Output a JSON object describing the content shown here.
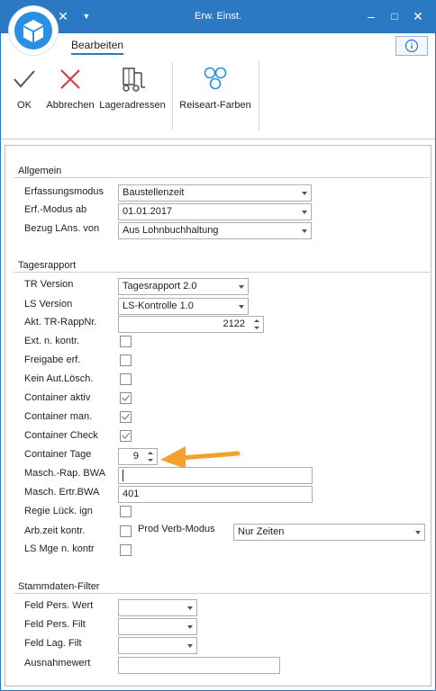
{
  "window": {
    "title": "Erw. Einst."
  },
  "ribbon": {
    "tab": "Bearbeiten",
    "buttons": {
      "ok": "OK",
      "cancel": "Abbrechen",
      "addresses": "Lageradressen",
      "colors": "Reiseart-Farben"
    }
  },
  "allgemein": {
    "title": "Allgemein",
    "erfassungsmodus_label": "Erfassungsmodus",
    "erfassungsmodus_value": "Baustellenzeit",
    "erf_modus_ab_label": "Erf.-Modus ab",
    "erf_modus_ab_value": "01.01.2017",
    "bezug_label": "Bezug LAns. von",
    "bezug_value": "Aus Lohnbuchhaltung"
  },
  "tagesrapport": {
    "title": "Tagesrapport",
    "tr_version_label": "TR Version",
    "tr_version_value": "Tagesrapport 2.0",
    "ls_version_label": "LS Version",
    "ls_version_value": "LS-Kontrolle 1.0",
    "akt_tr_label": "Akt. TR-RappNr.",
    "akt_tr_value": "2122",
    "ext_label": "Ext. n. kontr.",
    "freigabe_label": "Freigabe erf.",
    "kein_label": "Kein Aut.Lösch.",
    "container_aktiv_label": "Container aktiv",
    "container_man_label": "Container man.",
    "container_check_label": "Container Check",
    "container_tage_label": "Container Tage",
    "container_tage_value": "9",
    "masch_rap_label": "Masch.-Rap. BWA",
    "masch_rap_value": "",
    "masch_ertr_label": "Masch. Ertr.BWA",
    "masch_ertr_value": "401",
    "regie_label": "Regie Lück. ign",
    "arbzeit_label": "Arb.zeit kontr.",
    "prod_label": "Prod Verb-Modus",
    "prod_value": "Nur Zeiten",
    "ls_mge_label": "LS Mge n. kontr"
  },
  "stammdaten": {
    "title": "Stammdaten-Filter",
    "feld_pers_wert_label": "Feld Pers. Wert",
    "feld_pers_filt_label": "Feld Pers. Filt",
    "feld_lag_filt_label": "Feld Lag. Filt",
    "ausnahmewert_label": "Ausnahmewert"
  },
  "colors": {
    "accent": "#2b79c2",
    "annotation": "#f5a02a"
  }
}
